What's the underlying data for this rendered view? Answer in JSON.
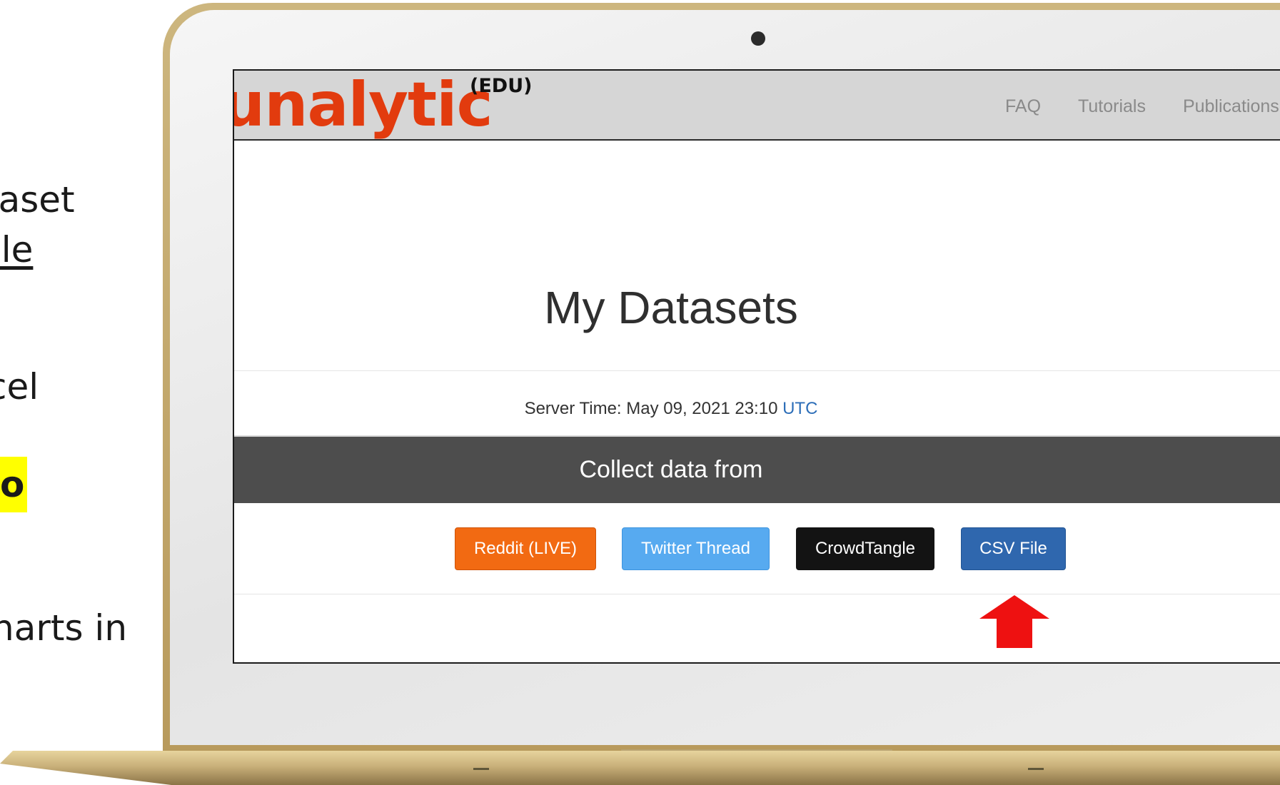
{
  "slide": {
    "line1": "taset",
    "line2": "ple",
    "line3": "cel",
    "line4": "o",
    "line5": "harts in"
  },
  "app": {
    "logo_text": "unalytic",
    "logo_badge": "(EDU)",
    "brand_color": "#e23b0e",
    "nav": [
      "FAQ",
      "Tutorials",
      "Publications"
    ]
  },
  "main": {
    "title": "My Datasets",
    "server_time_label": "Server Time: May 09, 2021 23:10",
    "server_time_zone": "UTC",
    "collect_label": "Collect data from",
    "sources": [
      {
        "label": "Reddit (LIVE)",
        "color": "#f26a12"
      },
      {
        "label": "Twitter Thread",
        "color": "#57aaf0"
      },
      {
        "label": "CrowdTangle",
        "color": "#131313"
      },
      {
        "label": "CSV File",
        "color": "#2f67ae"
      }
    ]
  },
  "annotation": {
    "arrow_color": "#ee1111",
    "arrow_icon": "arrow-up-icon"
  }
}
